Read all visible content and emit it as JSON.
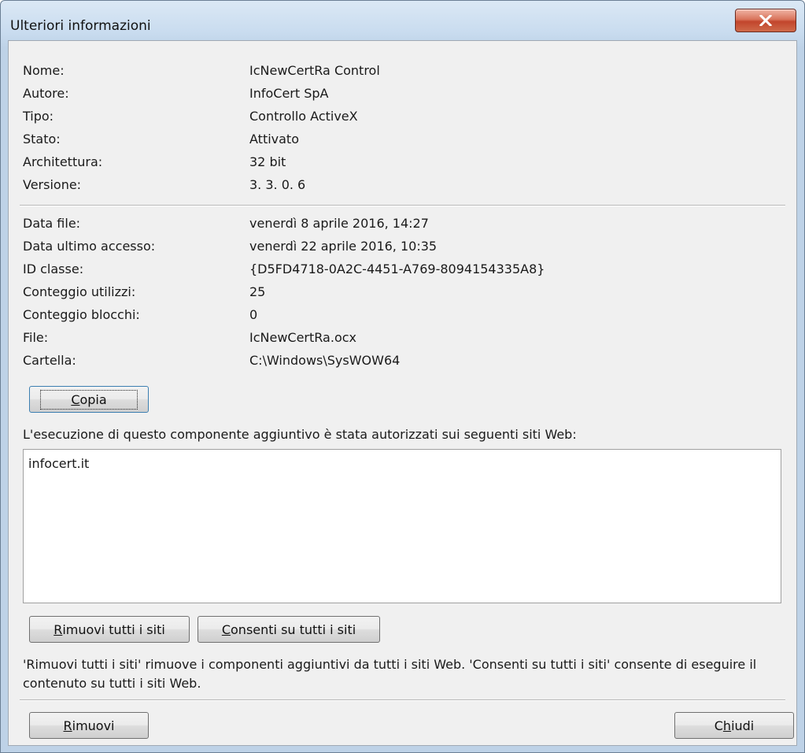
{
  "window": {
    "title": "Ulteriori informazioni"
  },
  "info_group1": [
    {
      "label": "Nome:",
      "value": "IcNewCertRa Control"
    },
    {
      "label": "Autore:",
      "value": "InfoCert SpA"
    },
    {
      "label": "Tipo:",
      "value": "Controllo ActiveX"
    },
    {
      "label": "Stato:",
      "value": "Attivato"
    },
    {
      "label": "Architettura:",
      "value": "32 bit"
    },
    {
      "label": "Versione:",
      "value": "3. 3. 0. 6"
    }
  ],
  "info_group2": [
    {
      "label": "Data file:",
      "value": "venerdì 8 aprile 2016, 14:27"
    },
    {
      "label": "Data ultimo accesso:",
      "value": "venerdì 22 aprile 2016, 10:35"
    },
    {
      "label": "ID classe:",
      "value": "{D5FD4718-0A2C-4451-A769-8094154335A8}"
    },
    {
      "label": "Conteggio utilizzi:",
      "value": "25"
    },
    {
      "label": "Conteggio blocchi:",
      "value": "0"
    },
    {
      "label": "File:",
      "value": "IcNewCertRa.ocx"
    },
    {
      "label": "Cartella:",
      "value": "C:\\Windows\\SysWOW64"
    }
  ],
  "copy_button": {
    "accel": "C",
    "rest": "opia"
  },
  "authorized_sites_label": "L'esecuzione di questo componente aggiuntivo è stata autorizzati sui seguenti siti Web:",
  "authorized_sites": [
    "infocert.it"
  ],
  "remove_all_button": {
    "accel": "R",
    "rest": "imuovi tutti i siti"
  },
  "allow_all_button": {
    "accel": "C",
    "rest": "onsenti su tutti i siti"
  },
  "note_text": "'Rimuovi tutti i siti' rimuove i componenti aggiuntivi da tutti i siti Web. 'Consenti su tutti i siti' consente di eseguire il contenuto su tutti i siti Web.",
  "remove_button": {
    "accel": "R",
    "rest": "imuovi"
  },
  "close_button": {
    "prefix": "C",
    "accel": "h",
    "rest": "iudi"
  },
  "icons": {
    "close": "close-x-icon"
  }
}
